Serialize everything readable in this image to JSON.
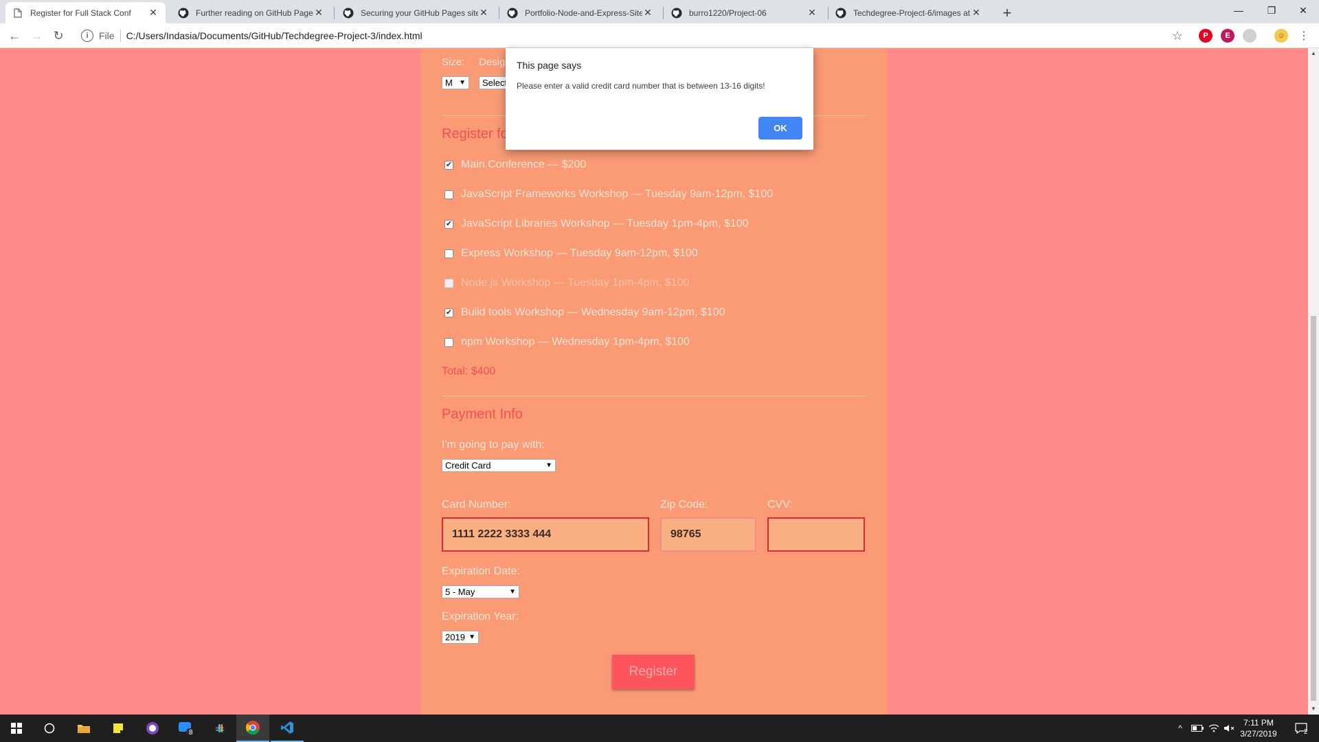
{
  "browser": {
    "tabs": [
      {
        "title": "Register for Full Stack Conf",
        "active": true,
        "icon": "page-icon"
      },
      {
        "title": "Further reading on GitHub Pages",
        "active": false,
        "icon": "github-icon"
      },
      {
        "title": "Securing your GitHub Pages site",
        "active": false,
        "icon": "github-icon"
      },
      {
        "title": "Portfolio-Node-and-Express-Site",
        "active": false,
        "icon": "github-icon"
      },
      {
        "title": "burro1220/Project-06",
        "active": false,
        "icon": "github-icon"
      },
      {
        "title": "Techdegree-Project-6/images at",
        "active": false,
        "icon": "github-icon"
      }
    ],
    "address": {
      "scheme": "File",
      "url": "C:/Users/Indasia/Documents/GitHub/Techdegree-Project-3/index.html"
    }
  },
  "page": {
    "shirt": {
      "size_label": "Size:",
      "size_value": "M",
      "design_label": "Design:",
      "design_value": "Select Theme"
    },
    "activities": {
      "title": "Register for Activities",
      "items": [
        {
          "label": "Main Conference — $200",
          "checked": true,
          "disabled": false
        },
        {
          "label": "JavaScript Frameworks Workshop — Tuesday 9am-12pm, $100",
          "checked": false,
          "disabled": false
        },
        {
          "label": "JavaScript Libraries Workshop — Tuesday 1pm-4pm, $100",
          "checked": true,
          "disabled": false
        },
        {
          "label": "Express Workshop — Tuesday 9am-12pm, $100",
          "checked": false,
          "disabled": false
        },
        {
          "label": "Node.js Workshop — Tuesday 1pm-4pm, $100",
          "checked": false,
          "disabled": true
        },
        {
          "label": "Build tools Workshop — Wednesday 9am-12pm, $100",
          "checked": true,
          "disabled": false
        },
        {
          "label": "npm Workshop — Wednesday 1pm-4pm, $100",
          "checked": false,
          "disabled": false
        }
      ],
      "total": "Total: $400"
    },
    "payment": {
      "title": "Payment Info",
      "pay_label": "I'm going to pay with:",
      "pay_value": "Credit Card",
      "card_label": "Card Number:",
      "card_value": "1111 2222 3333 444",
      "zip_label": "Zip Code:",
      "zip_value": "98765",
      "cvv_label": "CVV:",
      "cvv_value": "",
      "exp_date_label": "Expiration Date:",
      "exp_date_value": "5 - May",
      "exp_year_label": "Expiration Year:",
      "exp_year_value": "2019"
    },
    "register_label": "Register"
  },
  "dialog": {
    "title": "This page says",
    "message": "Please enter a valid credit card number that is between 13-16 digits!",
    "ok_label": "OK"
  },
  "taskbar": {
    "time": "7:11 PM",
    "date": "3/27/2019",
    "messenger_badge": "8",
    "notification_count": "2"
  },
  "colors": {
    "page_bg": "#ff8b8b",
    "form_bg": "#fa9b76",
    "accent": "#f44e58",
    "error_border": "#e8262c",
    "dialog_button": "#4285f4"
  }
}
